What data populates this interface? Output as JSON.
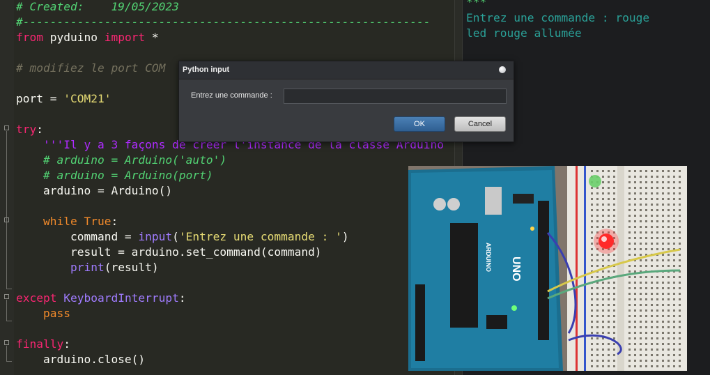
{
  "editor": {
    "lines": {
      "l1": "# Created:    19/05/2023",
      "l2": "#------------------------------------------------------------",
      "l3a": "from",
      "l3b": " pyduino ",
      "l3c": "import",
      "l3d": " *",
      "l5": "# modifiez le port COM ",
      "l7a": "port = ",
      "l7b": "'COM21'",
      "l9a": "try",
      "l9b": ":",
      "l10": "    '''Il y a 3 façons de créer l'instance de la classe Arduino",
      "l11": "    # arduino = Arduino('auto')",
      "l12": "    # arduino = Arduino(port)",
      "l13": "    arduino = Arduino()",
      "l15a": "    while",
      "l15b": " True",
      "l15c": ":",
      "l16a": "        command = ",
      "l16b": "input",
      "l16c": "(",
      "l16d": "'Entrez une commande : '",
      "l16e": ")",
      "l17": "        result = arduino.set_command(command)",
      "l18a": "        print",
      "l18b": "(result)",
      "l20a": "except",
      "l20b": " KeyboardInterrupt",
      "l20c": ":",
      "l21": "    pass",
      "l23a": "finally",
      "l23b": ":",
      "l24": "    arduino.close()"
    }
  },
  "console": {
    "line0": "***",
    "line1": "Entrez une commande : rouge",
    "line2": "led rouge allumée"
  },
  "dialog": {
    "title": "Python input",
    "prompt_label": "Entrez une commande :",
    "input_value": "",
    "ok_label": "OK",
    "cancel_label": "Cancel"
  },
  "photo": {
    "board_label": "UNO",
    "brand_label": "ARDUINO",
    "icons": [
      "arduino-board",
      "red-led-lit",
      "green-led",
      "breadboard"
    ]
  },
  "colors": {
    "editor_bg": "#282923",
    "console_bg": "#1c1d1f",
    "console_text": "#2aa198",
    "keyword": "#f92672",
    "string": "#e6db74",
    "comment_green": "#52d273",
    "docstring": "#ae2bff",
    "ok_button": "#3a6ea5"
  }
}
